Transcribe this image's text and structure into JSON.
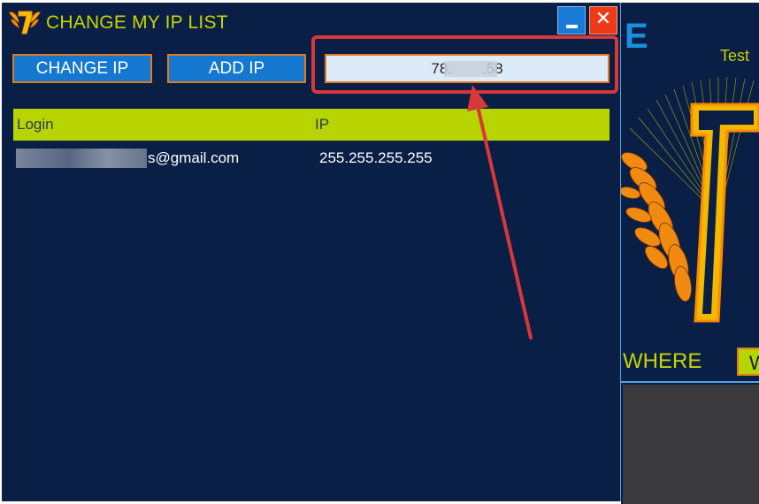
{
  "window": {
    "title": "CHANGE MY IP LIST"
  },
  "toolbar": {
    "change_ip_label": "CHANGE IP",
    "add_ip_label": "ADD IP",
    "ip_value": "78.  .58"
  },
  "table": {
    "columns": [
      "Login",
      "IP"
    ],
    "rows": [
      {
        "login": "s@gmail.com",
        "ip": "255.255.255.255"
      }
    ]
  },
  "background_app": {
    "top_letter": "E",
    "test_label": "Test",
    "where_label": "WHERE",
    "w_button_label": "W"
  },
  "icons": {
    "logo": "winged-seven-logo-icon",
    "minimize": "minimize-icon",
    "close": "close-icon"
  },
  "colors": {
    "window_bg": "#0a1f45",
    "accent_yellow": "#c8d400",
    "header_green": "#b8d400",
    "button_blue": "#1478d0",
    "button_border": "#e07a1a",
    "close_red": "#ef3a1a",
    "annotation_red": "#d7383a"
  }
}
